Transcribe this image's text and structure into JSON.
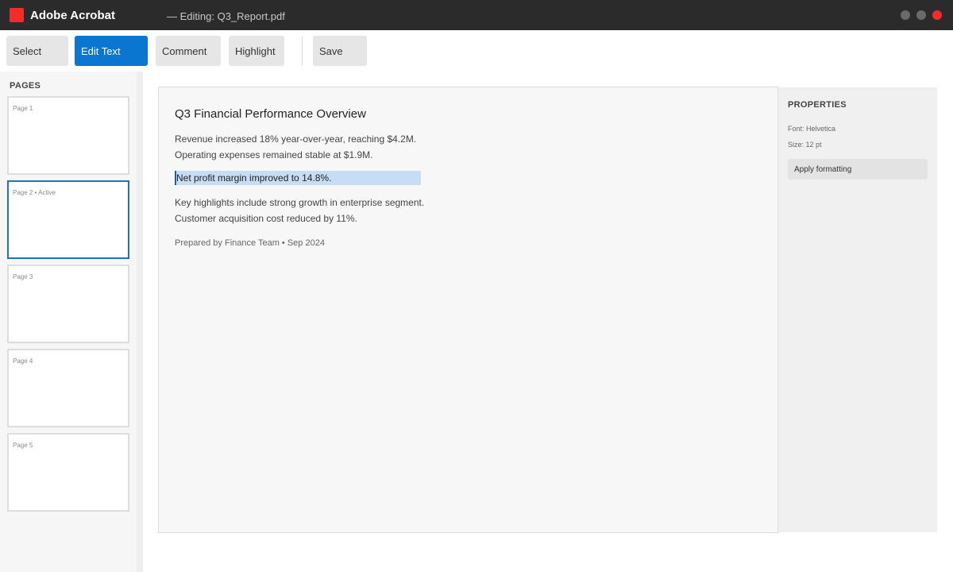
{
  "titlebar": {
    "app_name": "Adobe Acrobat",
    "doc_title": "— Editing: Q3_Report.pdf",
    "logo_color": "#f22b2b",
    "close_color": "#f52b2b"
  },
  "toolbar": {
    "select_label": "Select",
    "edit_text_label": "Edit Text",
    "comment_label": "Comment",
    "highlight_label": "Highlight",
    "save_label": "Save",
    "active_tool": "Edit Text",
    "accent_color": "#0a76d0"
  },
  "sidebar": {
    "heading": "PAGES",
    "pages": [
      {
        "label": "Page 1"
      },
      {
        "label": "Page 2 • Active"
      },
      {
        "label": "Page 3"
      },
      {
        "label": "Page 4"
      },
      {
        "label": "Page 5"
      }
    ]
  },
  "document": {
    "heading": "Q3 Financial Performance Overview",
    "lines": [
      "Revenue increased 18% year-over-year, reaching $4.2M.",
      "Operating expenses remained stable at $1.9M.",
      "Net profit margin improved to 14.8%.",
      "Key highlights include strong growth in enterprise segment.",
      "Customer acquisition cost reduced by 11%."
    ],
    "footer": "Prepared by Finance Team • Sep 2024",
    "selection_color": "#c7ddf5"
  },
  "properties": {
    "heading": "PROPERTIES",
    "font": "Font: Helvetica",
    "size": "Size: 12 pt",
    "apply_label": "Apply formatting"
  }
}
